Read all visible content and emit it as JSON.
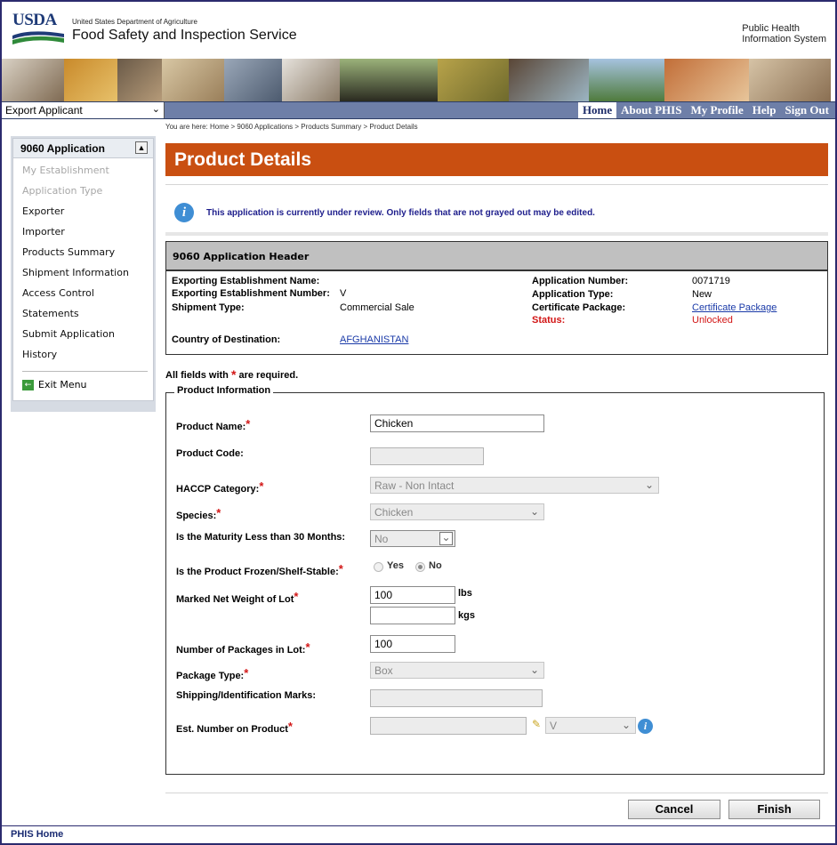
{
  "header": {
    "usda": "USDA",
    "department": "United States Department of Agriculture",
    "agency": "Food Safety and Inspection Service",
    "system_line1": "Public Health",
    "system_line2": "Information System"
  },
  "nav": {
    "role": "Export Applicant",
    "links": [
      "Home",
      "About PHIS",
      "My Profile",
      "Help",
      "Sign Out"
    ]
  },
  "sidebar": {
    "title": "9060 Application",
    "items": [
      {
        "label": "My Establishment",
        "disabled": true
      },
      {
        "label": "Application Type",
        "disabled": true
      },
      {
        "label": "Exporter",
        "disabled": false
      },
      {
        "label": "Importer",
        "disabled": false
      },
      {
        "label": "Products Summary",
        "disabled": false
      },
      {
        "label": "Shipment Information",
        "disabled": false
      },
      {
        "label": "Access Control",
        "disabled": false
      },
      {
        "label": "Statements",
        "disabled": false
      },
      {
        "label": "Submit Application",
        "disabled": false
      },
      {
        "label": "History",
        "disabled": false
      }
    ],
    "exit": "Exit Menu"
  },
  "breadcrumb": "You are here: Home > 9060 Applications > Products Summary > Product Details",
  "page_title": "Product Details",
  "notice": "This application is currently under review. Only fields that are not grayed out may be edited.",
  "app_header": {
    "title": "9060 Application Header",
    "exporting_establishment_name_label": "Exporting Establishment Name:",
    "exporting_establishment_number_label": "Exporting Establishment Number:",
    "exporting_establishment_number": "V",
    "shipment_type_label": "Shipment Type:",
    "shipment_type": "Commercial Sale",
    "country_label": "Country of Destination:",
    "country": "AFGHANISTAN",
    "application_number_label": "Application Number:",
    "application_number": "0071719",
    "application_type_label": "Application Type:",
    "application_type": "New",
    "certificate_package_label": "Certificate Package:",
    "certificate_package": "Certificate Package",
    "status_label": "Status:",
    "status": "Unlocked"
  },
  "required_note_pre": "All fields with",
  "required_note_post": "are required.",
  "required_star": "*",
  "product_info": {
    "legend": "Product Information",
    "product_name_label": "Product Name:",
    "product_name": "Chicken",
    "product_code_label": "Product Code:",
    "product_code": "",
    "haccp_label": "HACCP Category:",
    "haccp": "Raw - Non Intact",
    "species_label": "Species:",
    "species": "Chicken",
    "maturity_label": "Is the Maturity Less than 30 Months:",
    "maturity": "No",
    "frozen_label": "Is the Product Frozen/Shelf-Stable:",
    "frozen_yes": "Yes",
    "frozen_no": "No",
    "frozen_selected": "No",
    "net_weight_label": "Marked Net Weight of Lot",
    "net_weight_lbs": "100",
    "unit_lbs": "lbs",
    "net_weight_kgs": "",
    "unit_kgs": "kgs",
    "packages_label": "Number of Packages in Lot:",
    "packages": "100",
    "package_type_label": "Package Type:",
    "package_type": "Box",
    "shipping_marks_label": "Shipping/Identification Marks:",
    "shipping_marks": "",
    "est_number_label": "Est. Number on Product",
    "est_number": "",
    "est_select": "V"
  },
  "buttons": {
    "cancel": "Cancel",
    "finish": "Finish"
  },
  "footer": "PHIS Home"
}
